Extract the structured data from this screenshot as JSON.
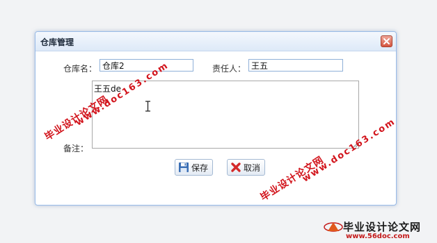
{
  "dialog": {
    "title": "仓库管理",
    "fields": {
      "warehouse_name_label": "仓库名：",
      "warehouse_name_value": "仓库2",
      "manager_label": "责任人：",
      "manager_value": "王五",
      "remarks_label": "备注：",
      "remarks_value": "王五de"
    },
    "buttons": {
      "save_label": "保存",
      "cancel_label": "取消"
    }
  },
  "watermarks": {
    "site_name": "毕业设计论文网",
    "site_url": "www.doc163.com"
  },
  "logo": {
    "text": "毕业设计论文网",
    "url": "www.56doc.com"
  },
  "colors": {
    "dialog_border": "#99bbe8",
    "watermark_red": "#d2141c",
    "close_button": "#d4553f"
  }
}
